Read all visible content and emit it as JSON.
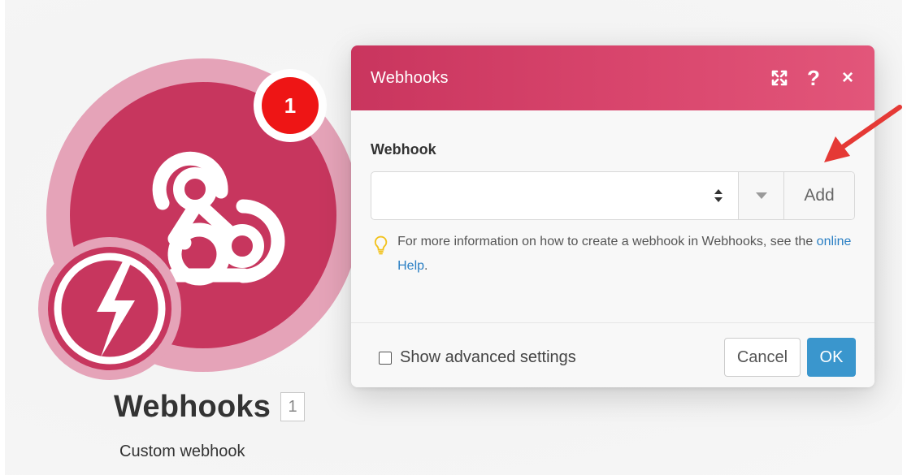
{
  "module": {
    "name": "Webhooks",
    "id": "1",
    "subtitle": "Custom webhook",
    "notification_count": "1",
    "icon": "webhook-icon",
    "trigger_icon": "lightning-bolt-icon",
    "colors": {
      "main": "#c7365e",
      "ring": "#e5a3b8",
      "badge": "#ee1515"
    }
  },
  "dialog": {
    "title": "Webhooks",
    "header_icons": [
      "expand-icon",
      "help-icon",
      "close-icon"
    ],
    "header_help_glyph": "?",
    "header_close_glyph": "×",
    "field": {
      "label": "Webhook",
      "value": "",
      "add_label": "Add"
    },
    "hint": {
      "text_before": "For more information on how to create a webhook in Webhooks, see the ",
      "link_text": "online Help",
      "text_after": "."
    },
    "footer": {
      "advanced_label": "Show advanced settings",
      "advanced_checked": false,
      "cancel_label": "Cancel",
      "ok_label": "OK"
    },
    "colors": {
      "header": "#d8456c",
      "ok": "#3a96cd",
      "link": "#2a7fc4"
    }
  },
  "annotation": {
    "arrow_color": "#e53935",
    "points_to": "add-button"
  }
}
